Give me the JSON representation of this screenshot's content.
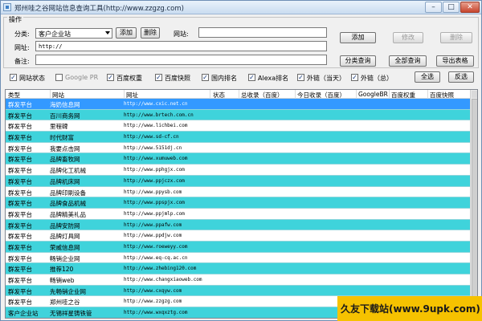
{
  "window": {
    "title": "郑州哇之谷网站信息查询工具(http://www.zzgzg.com)",
    "buttons": {
      "minimize": "–",
      "maximize": "□",
      "close": "✕"
    }
  },
  "form": {
    "group_label": "操作",
    "category_label": "分类:",
    "category_value": "客户企业站",
    "add_small": "添加",
    "delete_small": "删除",
    "site_label": "网站:",
    "site_value": "",
    "url_label": "网址:",
    "url_value": "http://",
    "note_label": "备注:",
    "note_value": ""
  },
  "buttons": {
    "add": "添加",
    "modify": "修改",
    "delete": "删除",
    "category_query": "分类查询",
    "query_all": "全部查询",
    "export": "导出表格",
    "select_all": "全选",
    "invert": "反选"
  },
  "checks": [
    {
      "label": "网站状态",
      "checked": true
    },
    {
      "label": "Google PR",
      "checked": false
    },
    {
      "label": "百度权重",
      "checked": true
    },
    {
      "label": "百度快照",
      "checked": true
    },
    {
      "label": "国内排名",
      "checked": true
    },
    {
      "label": "Alexa排名",
      "checked": true
    },
    {
      "label": "外链（当天）",
      "checked": true
    },
    {
      "label": "外链（总）",
      "checked": true
    }
  ],
  "table": {
    "columns": [
      "类型",
      "网站",
      "网址",
      "状态",
      "总收录（百度）",
      "今日收录（百度）",
      "GoogleBR",
      "百度权重",
      "百度快照"
    ],
    "rows": [
      {
        "type": "群发平台",
        "site": "海奶信息网",
        "url": "http://www.cxic.net.cn"
      },
      {
        "type": "群发平台",
        "site": "百川商务网",
        "url": "http://www.brtech.com.cn"
      },
      {
        "type": "群发平台",
        "site": "里程碑",
        "url": "http://www.lichbei.com"
      },
      {
        "type": "群发平台",
        "site": "时代财富",
        "url": "http://www.sd-cf.cn"
      },
      {
        "type": "群发平台",
        "site": "我要点击网",
        "url": "http://www.5151dj.cn"
      },
      {
        "type": "群发平台",
        "site": "品牌畜牧网",
        "url": "http://www.xumuweb.com"
      },
      {
        "type": "群发平台",
        "site": "品牌化工机械",
        "url": "http://www.pphgjx.com"
      },
      {
        "type": "群发平台",
        "site": "品牌机床网",
        "url": "http://www.ppjczx.com"
      },
      {
        "type": "群发平台",
        "site": "品牌印刷设备",
        "url": "http://www.ppysb.com"
      },
      {
        "type": "群发平台",
        "site": "品牌食品机械",
        "url": "http://www.ppspjx.com"
      },
      {
        "type": "群发平台",
        "site": "品牌精美礼品",
        "url": "http://www.ppjmlp.com"
      },
      {
        "type": "群发平台",
        "site": "品牌安防网",
        "url": "http://www.ppafw.com"
      },
      {
        "type": "群发平台",
        "site": "品牌灯具网",
        "url": "http://www.ppdjw.com"
      },
      {
        "type": "群发平台",
        "site": "荣威信息网",
        "url": "http://www.roeweyy.com"
      },
      {
        "type": "群发平台",
        "site": "畅销企业网",
        "url": "http://www.eq-cq.ac.cn"
      },
      {
        "type": "群发平台",
        "site": "推荐120",
        "url": "http://www.zhebing120.com"
      },
      {
        "type": "群发平台",
        "site": "畅销web",
        "url": "http://www.changxiaoweb.com"
      },
      {
        "type": "群发平台",
        "site": "先畅销企业网",
        "url": "http://www.cxqyw.com"
      },
      {
        "type": "群发平台",
        "site": "郑州哇之谷",
        "url": "http://www.zzgzg.com"
      },
      {
        "type": "客户企业站",
        "site": "无锡祥星铸铁管",
        "url": "http://www.wxqxztg.com"
      }
    ]
  },
  "watermark": "久友下载站(www.9upk.com)",
  "colors": {
    "row_alt": "#3fd3db",
    "row_selected": "#3399ff",
    "watermark_bg": "#f6c200"
  }
}
